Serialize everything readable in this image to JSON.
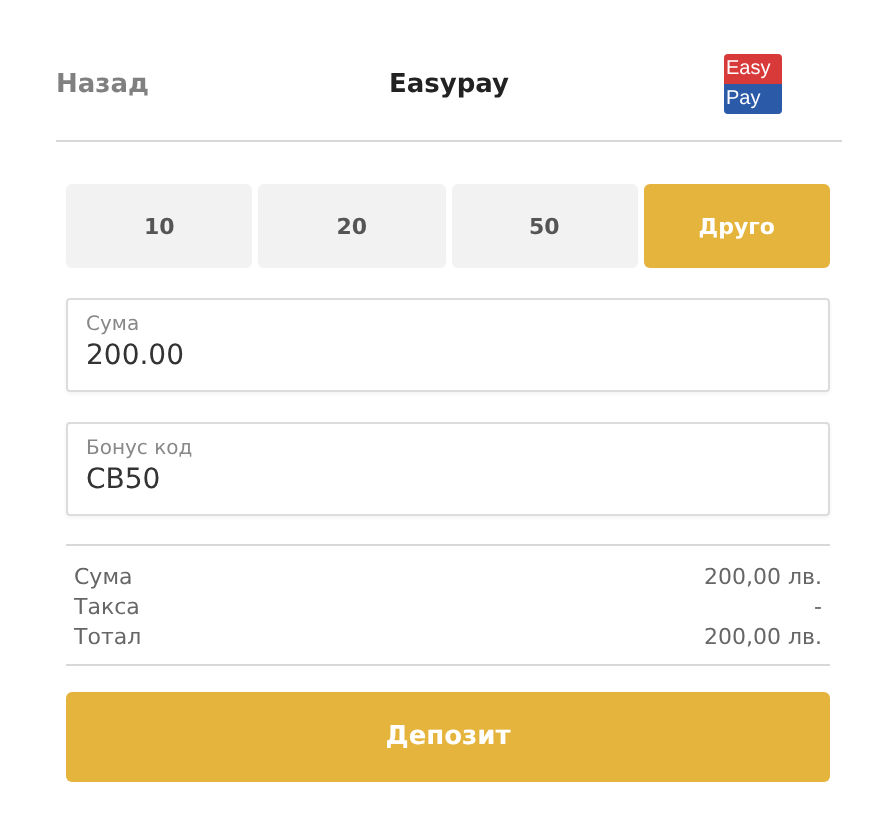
{
  "header": {
    "back": "Назад",
    "title": "Easypay",
    "logo": [
      "Easy",
      "Pay"
    ]
  },
  "amounts": [
    {
      "label": "10",
      "selected": false
    },
    {
      "label": "20",
      "selected": false
    },
    {
      "label": "50",
      "selected": false
    },
    {
      "label": "Друго",
      "selected": true
    }
  ],
  "fields": [
    {
      "label": "Сума",
      "value": "200.00"
    },
    {
      "label": "Бонус код",
      "value": "CB50"
    }
  ],
  "summary": [
    {
      "label": "Сума",
      "value": "200,00 лв."
    },
    {
      "label": "Такса",
      "value": "-"
    },
    {
      "label": "Тотал",
      "value": "200,00 лв."
    }
  ],
  "submit": "Депозит"
}
